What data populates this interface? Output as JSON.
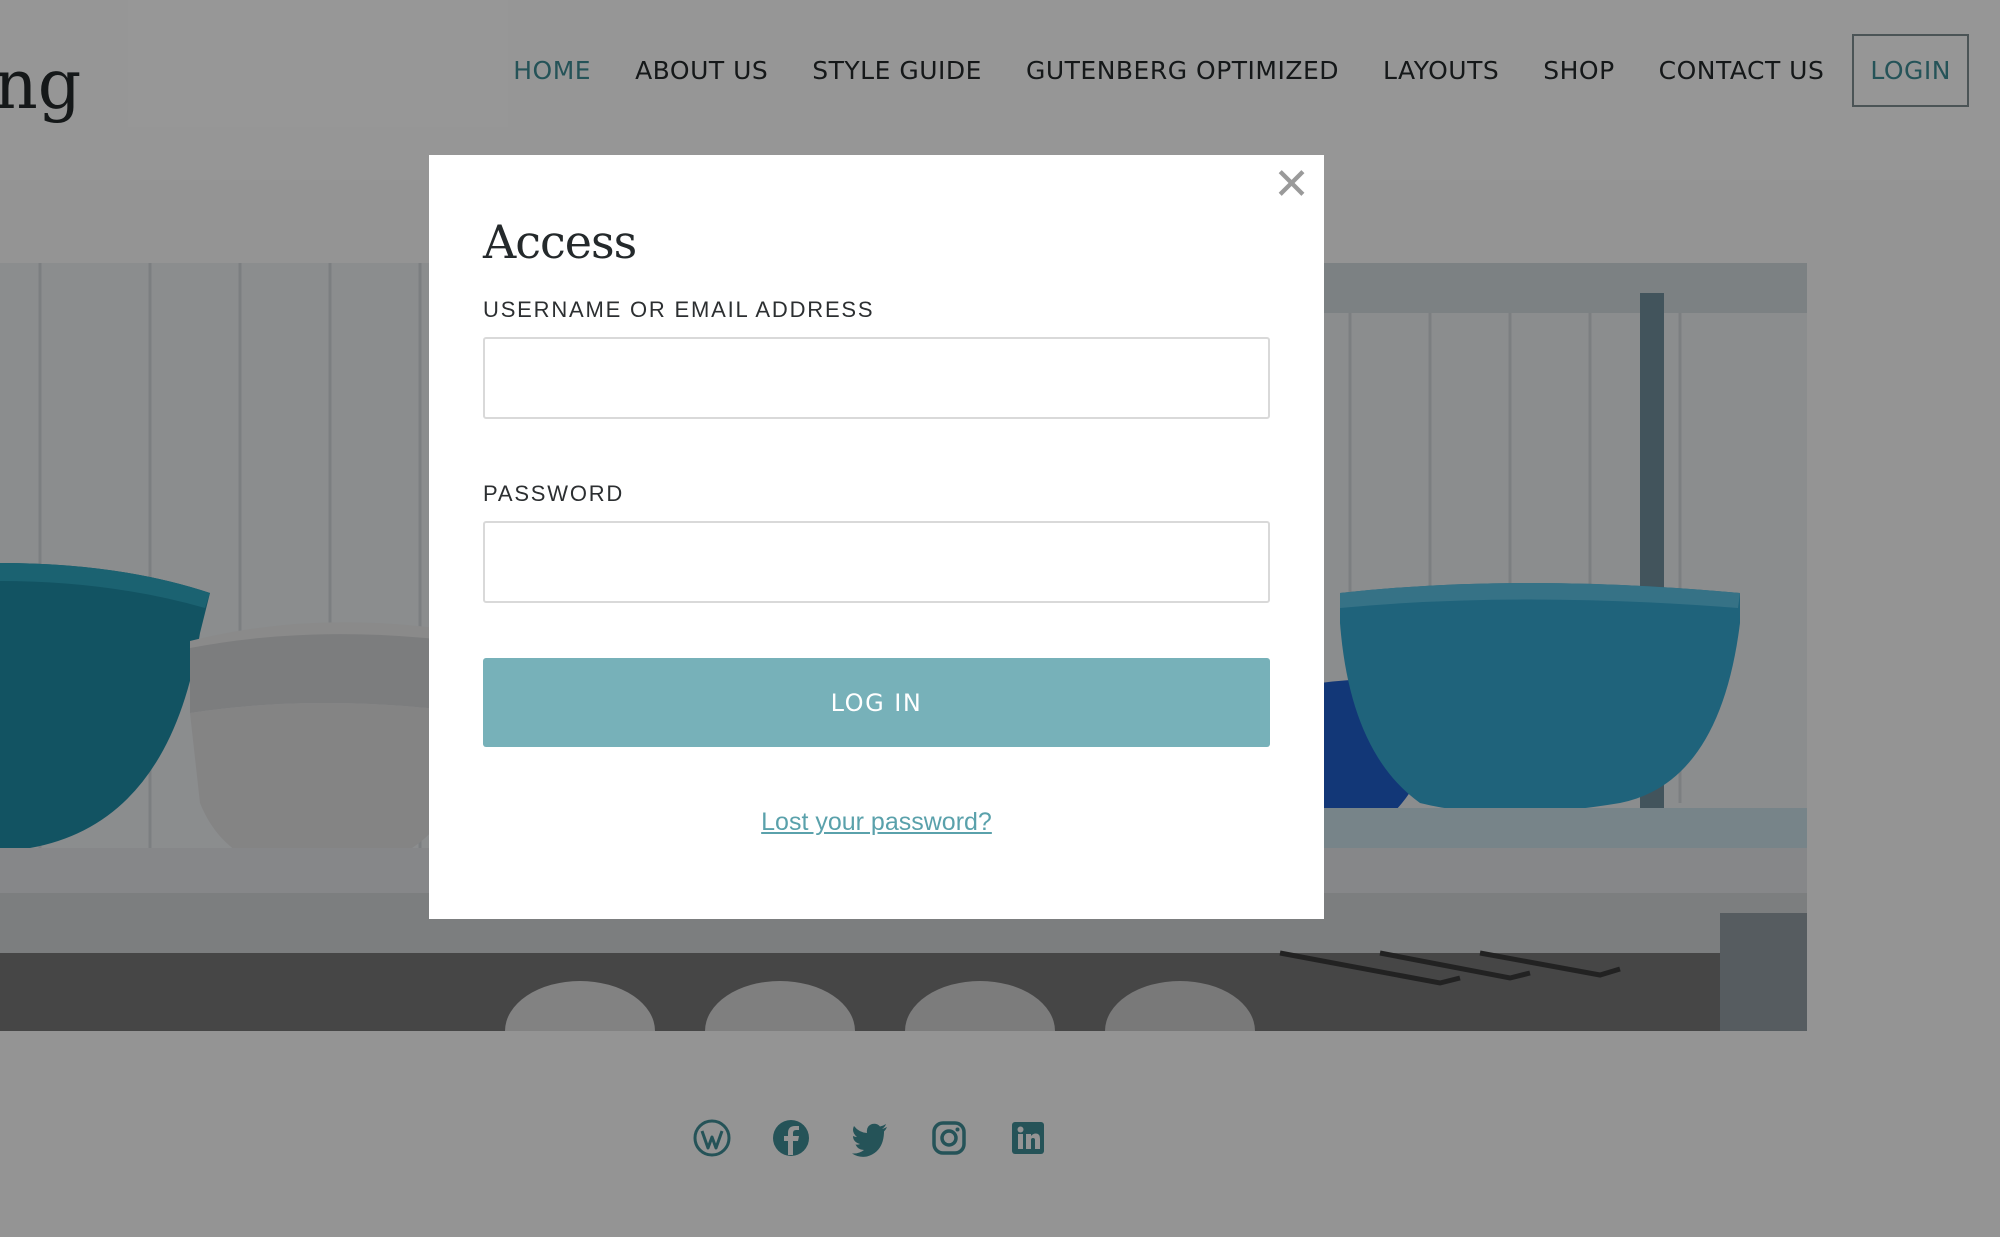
{
  "site": {
    "title_fragment": "ng"
  },
  "nav": {
    "items": [
      {
        "label": "HOME",
        "active": true
      },
      {
        "label": "ABOUT US",
        "active": false
      },
      {
        "label": "STYLE GUIDE",
        "active": false
      },
      {
        "label": "GUTENBERG OPTIMIZED",
        "active": false
      },
      {
        "label": "LAYOUTS",
        "active": false
      },
      {
        "label": "SHOP",
        "active": false
      },
      {
        "label": "CONTACT US",
        "active": false
      }
    ],
    "login_label": "LOGIN"
  },
  "modal": {
    "close_glyph": "✕",
    "title": "Access",
    "username_label": "USERNAME OR EMAIL ADDRESS",
    "username_value": "",
    "password_label": "PASSWORD",
    "password_value": "",
    "submit_label": "LOG IN",
    "lost_password_label": "Lost your password?"
  },
  "social": {
    "icons": [
      "wordpress-icon",
      "facebook-icon",
      "twitter-icon",
      "instagram-icon",
      "linkedin-icon"
    ]
  },
  "colors": {
    "accent": "#3e8a93",
    "button": "#77b1b9",
    "link": "#5aa1ab",
    "text_dark": "#24292b"
  }
}
